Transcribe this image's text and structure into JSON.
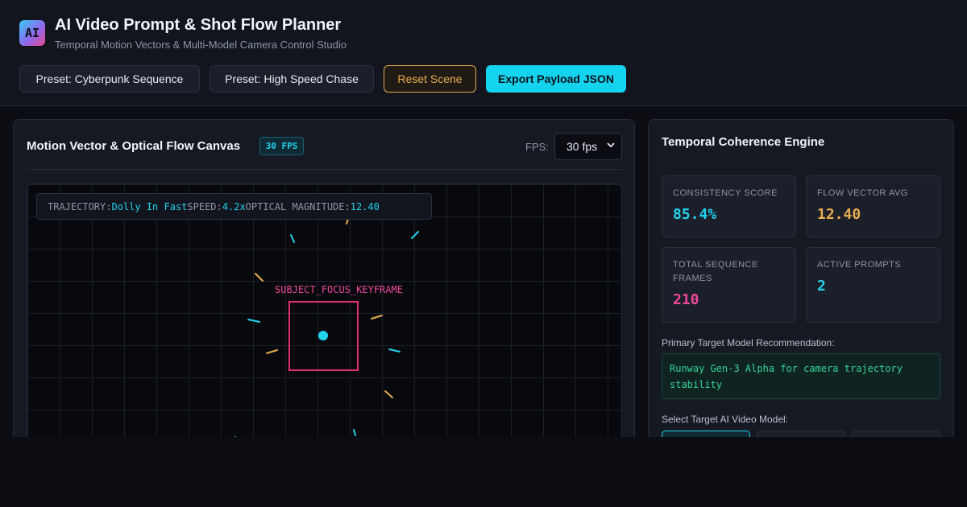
{
  "header": {
    "logo_text": "AI",
    "title": "AI Video Prompt & Shot Flow Planner",
    "subtitle": "Temporal Motion Vectors & Multi-Model Camera Control Studio",
    "buttons": {
      "preset_cyberpunk": "Preset: Cyberpunk Sequence",
      "preset_chase": "Preset: High Speed Chase",
      "reset": "Reset Scene",
      "export": "Export Payload JSON"
    }
  },
  "canvas_panel": {
    "title": "Motion Vector & Optical Flow Canvas",
    "fps_badge": "30 FPS",
    "fps_label": "FPS:",
    "fps_selected": "30 fps",
    "hud": {
      "trajectory_label": "TRAJECTORY:",
      "trajectory_value": "Dolly In Fast",
      "speed_label": "SPEED:",
      "speed_value": "4.2x",
      "magnitude_label": "OPTICAL MAGNITUDE:",
      "magnitude_value": "12.40"
    },
    "focus_label": "SUBJECT_FOCUS_KEYFRAME"
  },
  "engine_panel": {
    "title": "Temporal Coherence Engine",
    "stats": [
      {
        "label": "CONSISTENCY SCORE",
        "value": "85.4%",
        "color": "#22d3ee"
      },
      {
        "label": "FLOW VECTOR AVG",
        "value": "12.40",
        "color": "#e8ad50"
      },
      {
        "label": "TOTAL SEQUENCE FRAMES",
        "value": "210",
        "color": "#ec4899"
      },
      {
        "label": "ACTIVE PROMPTS",
        "value": "2",
        "color": "#22d3ee"
      }
    ],
    "recommendation_label": "Primary Target Model Recommendation:",
    "recommendation_text": "Runway Gen-3 Alpha for camera trajectory stability",
    "model_label": "Select Target AI Video Model:"
  },
  "colors": {
    "accent_cyan": "#22d3ee",
    "accent_orange": "#e8ad50",
    "accent_pink": "#e1306c",
    "success_green": "#34d399"
  }
}
